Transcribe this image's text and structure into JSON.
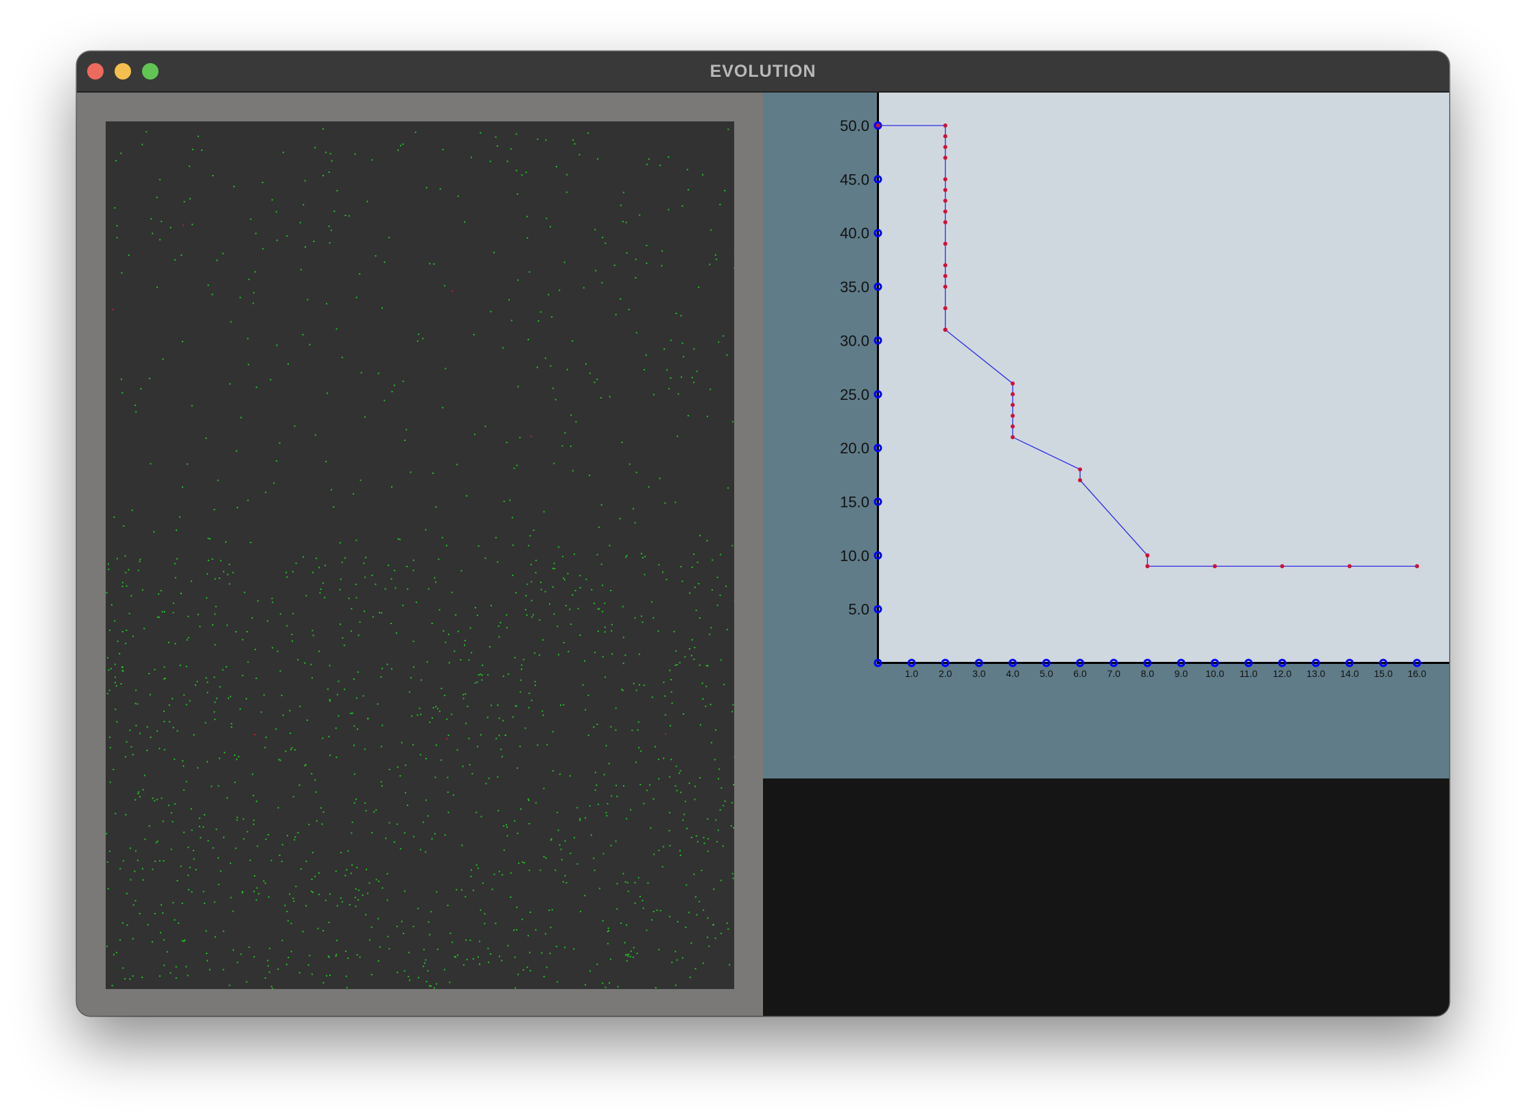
{
  "window": {
    "title": "EVOLUTION"
  },
  "colors": {
    "titlebar": "#393939",
    "simulation_background": "#323232",
    "creature": "#22c322",
    "predator": "#c81e2c",
    "panel_background": "#607c89",
    "plot_background": "#cfd8df",
    "line": "#2a2ae6",
    "axis_marker": "#0000ff",
    "data_point": "#d0103a",
    "console_background": "#151515"
  },
  "chart_data": {
    "type": "line",
    "title": "",
    "xlabel": "",
    "ylabel": "",
    "xlim": [
      0,
      17
    ],
    "ylim": [
      0,
      53
    ],
    "x_ticks": [
      "1.0",
      "2.0",
      "3.0",
      "4.0",
      "5.0",
      "6.0",
      "7.0",
      "8.0",
      "9.0",
      "10.0",
      "11.0",
      "12.0",
      "13.0",
      "14.0",
      "15.0",
      "16.0"
    ],
    "y_ticks": [
      "5.0",
      "10.0",
      "15.0",
      "20.0",
      "25.0",
      "30.0",
      "35.0",
      "40.0",
      "45.0",
      "50.0"
    ],
    "series": [
      {
        "x": [
          0,
          2,
          2,
          2,
          2,
          2,
          2,
          2,
          2,
          2,
          2,
          2,
          2,
          2,
          2,
          2,
          2,
          2,
          4,
          4,
          4,
          4,
          4,
          4,
          6,
          6,
          8,
          8,
          10,
          12,
          14,
          16
        ],
        "y": [
          50,
          50,
          49,
          48,
          47,
          45,
          44,
          43,
          42,
          41,
          39,
          37,
          36,
          35,
          33,
          31,
          31,
          31,
          26,
          25,
          24,
          23,
          22,
          21,
          18,
          17,
          10,
          9,
          9,
          9,
          9,
          9
        ]
      }
    ]
  }
}
